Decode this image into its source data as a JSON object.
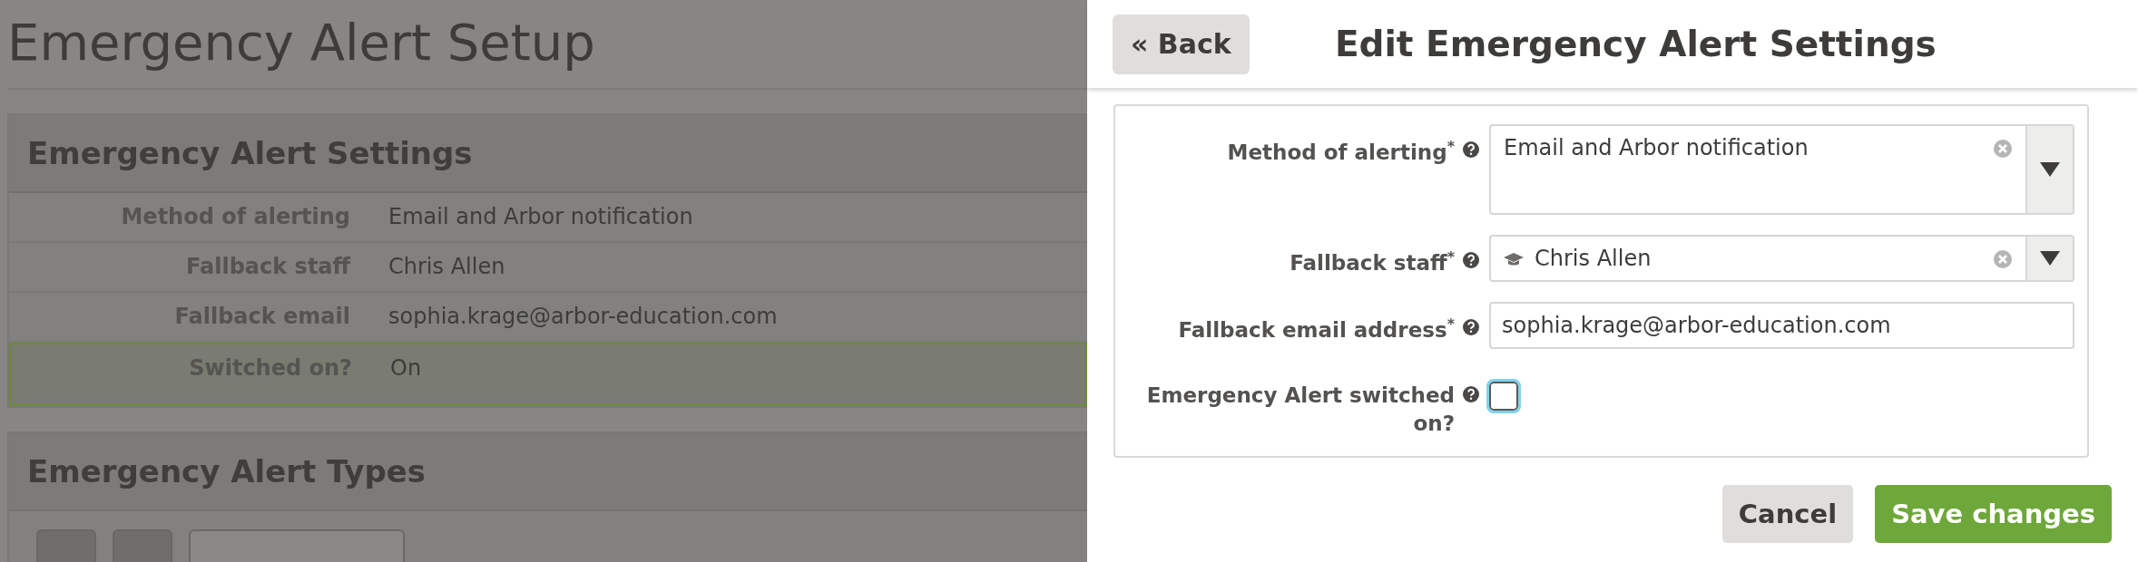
{
  "background_page": {
    "title": "Emergency Alert Setup",
    "settings_section": {
      "title": "Emergency Alert Settings",
      "rows": [
        {
          "label": "Method of alerting",
          "value": "Email and Arbor notification",
          "highlighted": false
        },
        {
          "label": "Fallback staff",
          "value": "Chris Allen",
          "highlighted": false
        },
        {
          "label": "Fallback email",
          "value": "sophia.krage@arbor-education.com",
          "highlighted": false
        },
        {
          "label": "Switched on?",
          "value": "On",
          "highlighted": true
        }
      ]
    },
    "types_section": {
      "title": "Emergency Alert Types"
    }
  },
  "edit_panel": {
    "back_button": "« Back",
    "title": "Edit Emergency Alert Settings",
    "fields": [
      {
        "kind": "multiline-select",
        "label": "Method of alerting$^{*}$",
        "value": "Email and Arbor notification"
      },
      {
        "kind": "person-select",
        "label": "Fallback staff$^{*}$",
        "value": "Chris Allen"
      },
      {
        "kind": "text",
        "label": "Fallback email address$^{*}$",
        "value": "sophia.krage@arbor-education.com"
      },
      {
        "kind": "checkbox",
        "label": "Emergency Alert switched on?",
        "checked": false
      }
    ],
    "buttons": [
      {
        "kind": "secondary",
        "label": "Cancel"
      },
      {
        "kind": "primary",
        "label": "Save changes"
      }
    ]
  }
}
